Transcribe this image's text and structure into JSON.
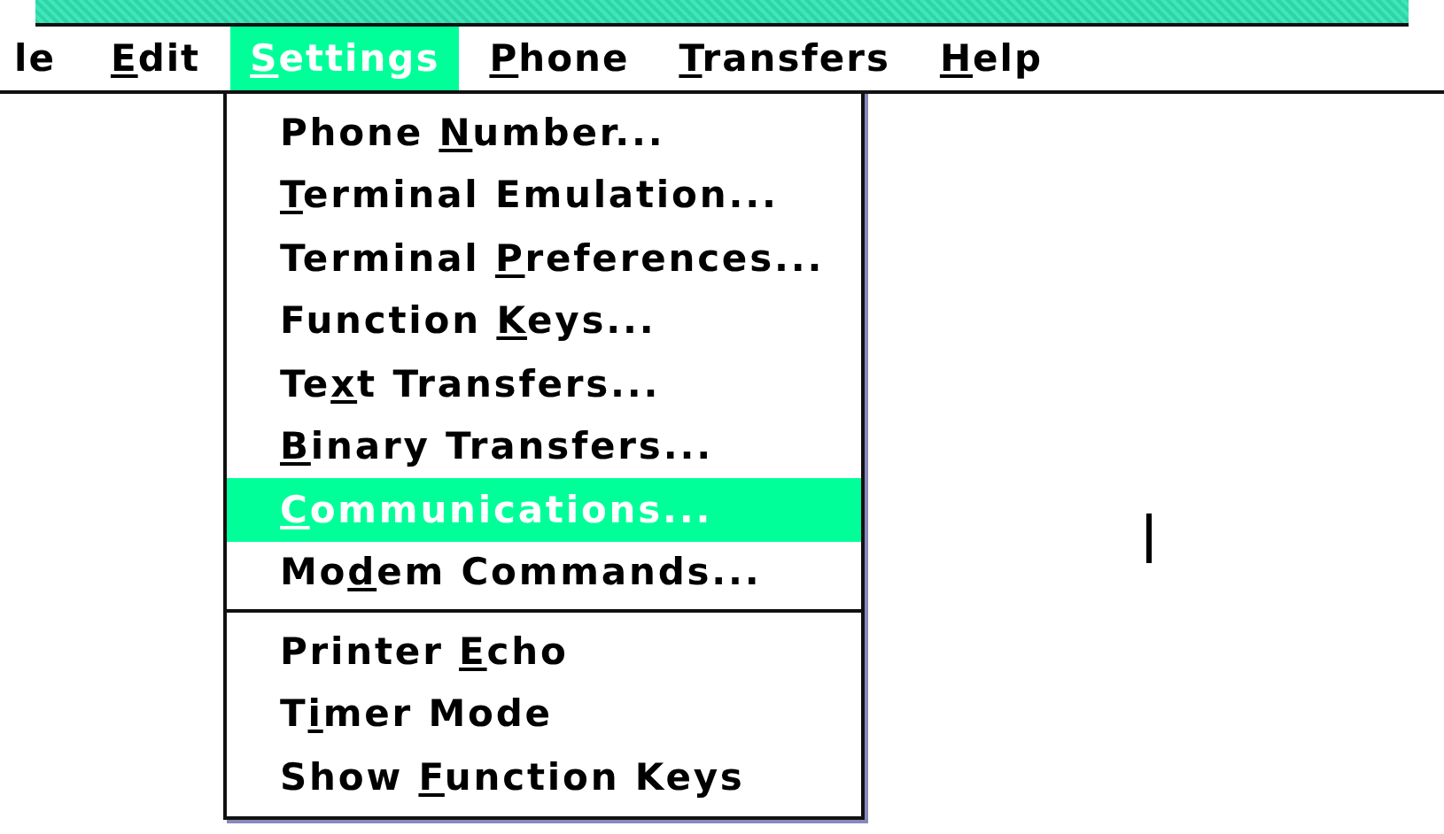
{
  "menubar": [
    {
      "label": {
        "pre": "l",
        "post": "e"
      },
      "selected": false
    },
    {
      "label": {
        "key": "E",
        "post": "dit"
      },
      "selected": false
    },
    {
      "label": {
        "key": "S",
        "post": "ettings"
      },
      "selected": true
    },
    {
      "label": {
        "key": "P",
        "post": "hone"
      },
      "selected": false
    },
    {
      "label": {
        "key": "T",
        "post": "ransfers"
      },
      "selected": false
    },
    {
      "label": {
        "key": "H",
        "post": "elp"
      },
      "selected": false
    }
  ],
  "menu": {
    "items": [
      {
        "kind": "command",
        "label": {
          "pre": "Phone ",
          "key": "N",
          "post": "umber..."
        },
        "selected": false
      },
      {
        "kind": "command",
        "label": {
          "key": "T",
          "post": "erminal Emulation..."
        },
        "selected": false
      },
      {
        "kind": "command",
        "label": {
          "pre": "Terminal ",
          "key": "P",
          "post": "references..."
        },
        "selected": false
      },
      {
        "kind": "command",
        "label": {
          "pre": "Function ",
          "key": "K",
          "post": "eys..."
        },
        "selected": false
      },
      {
        "kind": "command",
        "label": {
          "pre": "Te",
          "key": "x",
          "post": "t Transfers..."
        },
        "selected": false
      },
      {
        "kind": "command",
        "label": {
          "key": "B",
          "post": "inary Transfers..."
        },
        "selected": false
      },
      {
        "kind": "command",
        "label": {
          "key": "C",
          "post": "ommunications..."
        },
        "selected": true
      },
      {
        "kind": "command",
        "label": {
          "pre": "Mo",
          "key": "d",
          "post": "em Commands..."
        },
        "selected": false
      },
      {
        "kind": "separator"
      },
      {
        "kind": "command",
        "label": {
          "pre": "Printer ",
          "key": "E",
          "post": "cho"
        },
        "selected": false
      },
      {
        "kind": "command",
        "label": {
          "pre": "T",
          "key": "i",
          "post": "mer Mode"
        },
        "selected": false
      },
      {
        "kind": "command",
        "label": {
          "pre": "Show ",
          "key": "F",
          "post": "unction Keys"
        },
        "selected": false
      }
    ]
  }
}
